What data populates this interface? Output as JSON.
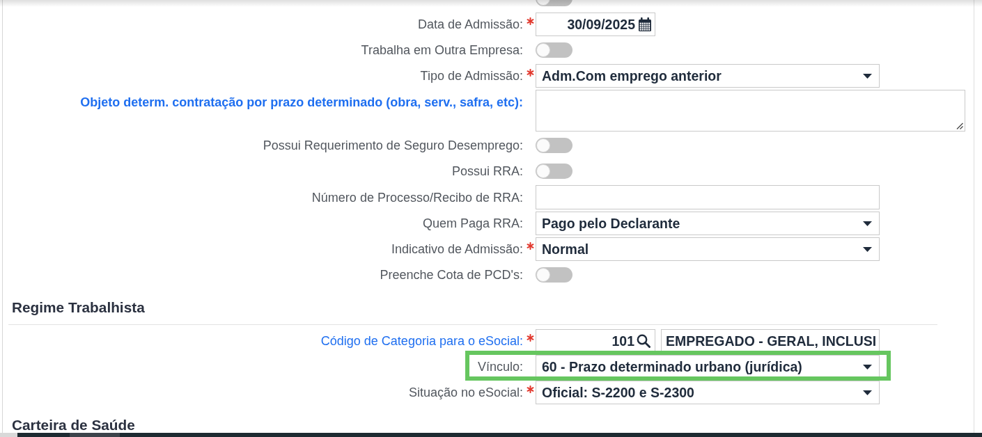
{
  "fields": [
    {
      "kind": "toggle",
      "required": false,
      "on": false
    },
    {
      "kind": "date",
      "label": "Data de Admissão:",
      "link": false,
      "bold": false,
      "required": true,
      "value": "30/09/2025"
    },
    {
      "kind": "toggle",
      "label": "Trabalha em Outra Empresa:",
      "link": false,
      "bold": false,
      "required": false,
      "on": false
    },
    {
      "kind": "select",
      "label": "Tipo de Admissão:",
      "link": false,
      "bold": false,
      "required": true,
      "value": "Adm.Com emprego anterior"
    },
    {
      "kind": "textarea",
      "label": "Objeto determ. contratação por prazo determinado (obra, serv., safra, etc):",
      "link": true,
      "bold": true,
      "required": false
    },
    {
      "kind": "toggle",
      "label": "Possui Requerimento de Seguro Desemprego:",
      "link": false,
      "bold": false,
      "required": false,
      "on": false
    },
    {
      "kind": "toggle",
      "label": "Possui RRA:",
      "link": false,
      "bold": false,
      "required": false,
      "on": false
    },
    {
      "kind": "text",
      "label": "Número de Processo/Recibo de RRA:",
      "link": false,
      "bold": false,
      "required": false
    },
    {
      "kind": "select",
      "label": "Quem Paga RRA:",
      "link": false,
      "bold": false,
      "required": false,
      "value": "Pago pelo Declarante"
    },
    {
      "kind": "select",
      "label": "Indicativo de Admissão:",
      "link": false,
      "bold": false,
      "required": true,
      "value": "Normal"
    },
    {
      "kind": "toggle",
      "label": "Preenche Cota de PCD's:",
      "link": false,
      "bold": false,
      "required": false,
      "on": false
    }
  ],
  "sections": [
    {
      "title": "Regime Trabalhista",
      "fields": [
        {
          "kind": "lookup",
          "label": "Código de Categoria para o eSocial:",
          "link": true,
          "bold": false,
          "required": true,
          "highlighted": false,
          "code": "101",
          "description": "EMPREGADO - GERAL, INCLUSI"
        },
        {
          "kind": "select",
          "label": "Vínculo:",
          "link": false,
          "bold": false,
          "required": false,
          "highlighted": true,
          "value": "60 - Prazo determinado urbano (jurídica)"
        },
        {
          "kind": "select",
          "label": "Situação no eSocial:",
          "link": false,
          "bold": false,
          "required": true,
          "highlighted": false,
          "value": "Oficial: S-2200 e S-2300"
        }
      ]
    },
    {
      "title": "Carteira de Saúde"
    }
  ]
}
